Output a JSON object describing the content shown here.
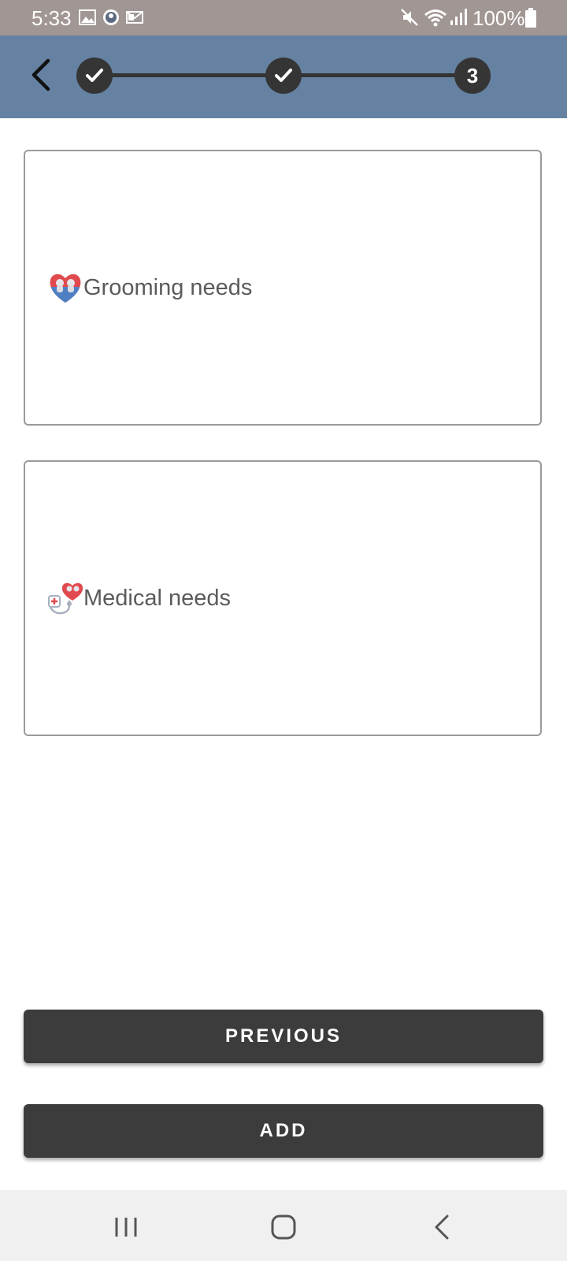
{
  "status_bar": {
    "time": "5:33",
    "battery": "100%"
  },
  "stepper": {
    "steps": [
      {
        "state": "done"
      },
      {
        "state": "done"
      },
      {
        "state": "current",
        "label": "3"
      }
    ]
  },
  "options": [
    {
      "label": "Grooming needs",
      "icon": "grooming-heart-icon"
    },
    {
      "label": "Medical needs",
      "icon": "stethoscope-heart-icon"
    }
  ],
  "buttons": {
    "previous": "PREVIOUS",
    "add": "ADD"
  },
  "colors": {
    "header": "#6682a2",
    "status_bar": "#a09693",
    "button": "#3c3c3c"
  }
}
